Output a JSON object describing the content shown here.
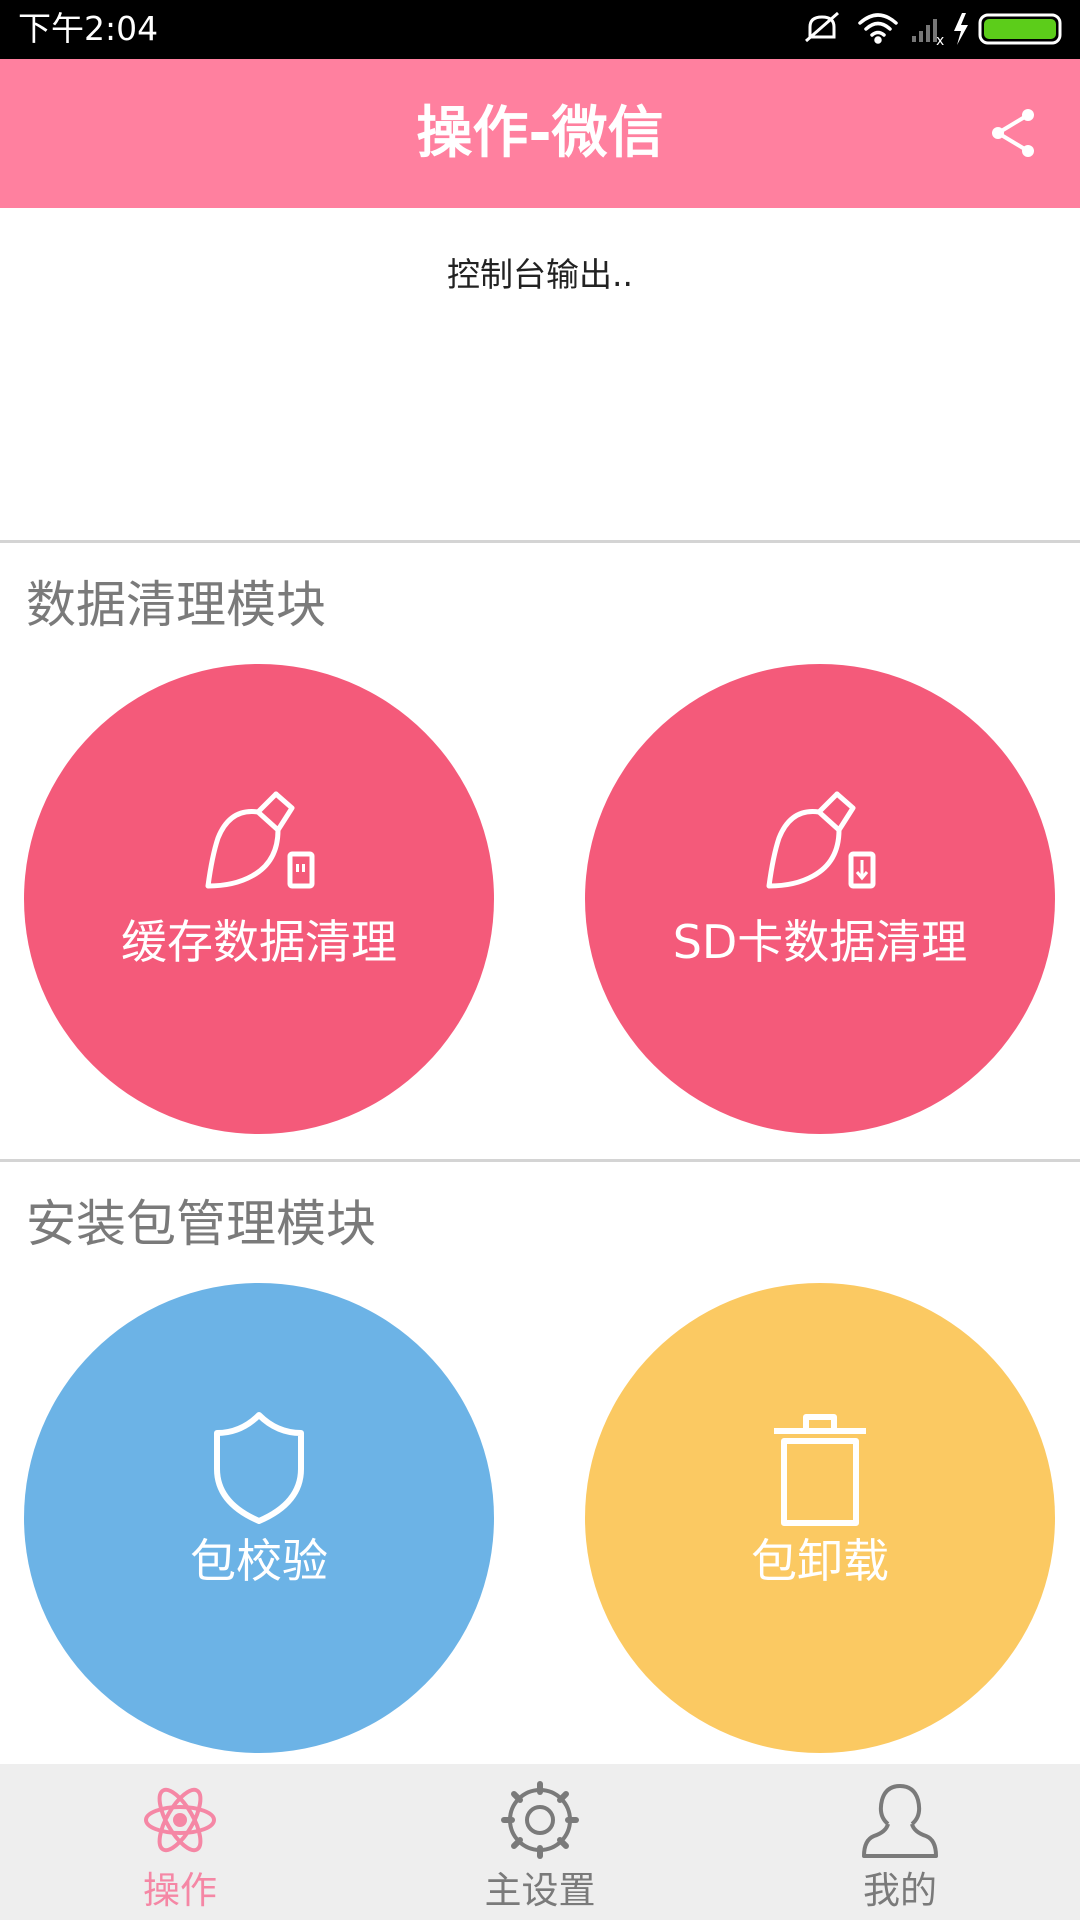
{
  "status_bar": {
    "time": "下午2:04",
    "icons": [
      "mute-icon",
      "wifi-icon",
      "signal-icon",
      "charging-icon",
      "battery-icon"
    ]
  },
  "header": {
    "title": "操作-微信",
    "share_icon": "share-icon",
    "color": "#ff809f"
  },
  "console": {
    "output": "控制台输出.."
  },
  "sections": [
    {
      "title": "数据清理模块",
      "buttons": [
        {
          "label": "缓存数据清理",
          "icon": "brush-icon",
          "color": "#f45a7a"
        },
        {
          "label": "SD卡数据清理",
          "icon": "brush-sd-icon",
          "color": "#f45a7a"
        }
      ]
    },
    {
      "title": "安装包管理模块",
      "buttons": [
        {
          "label": "包校验",
          "icon": "shield-icon",
          "color": "#6cb3e6"
        },
        {
          "label": "包卸载",
          "icon": "trash-icon",
          "color": "#fbc962"
        }
      ]
    }
  ],
  "tabbar": {
    "tabs": [
      {
        "label": "操作",
        "icon": "atom-icon",
        "active": true
      },
      {
        "label": "主设置",
        "icon": "gear-icon",
        "active": false
      },
      {
        "label": "我的",
        "icon": "user-icon",
        "active": false
      }
    ],
    "active_color": "#f587a5",
    "inactive_color": "#7a7a7a"
  }
}
